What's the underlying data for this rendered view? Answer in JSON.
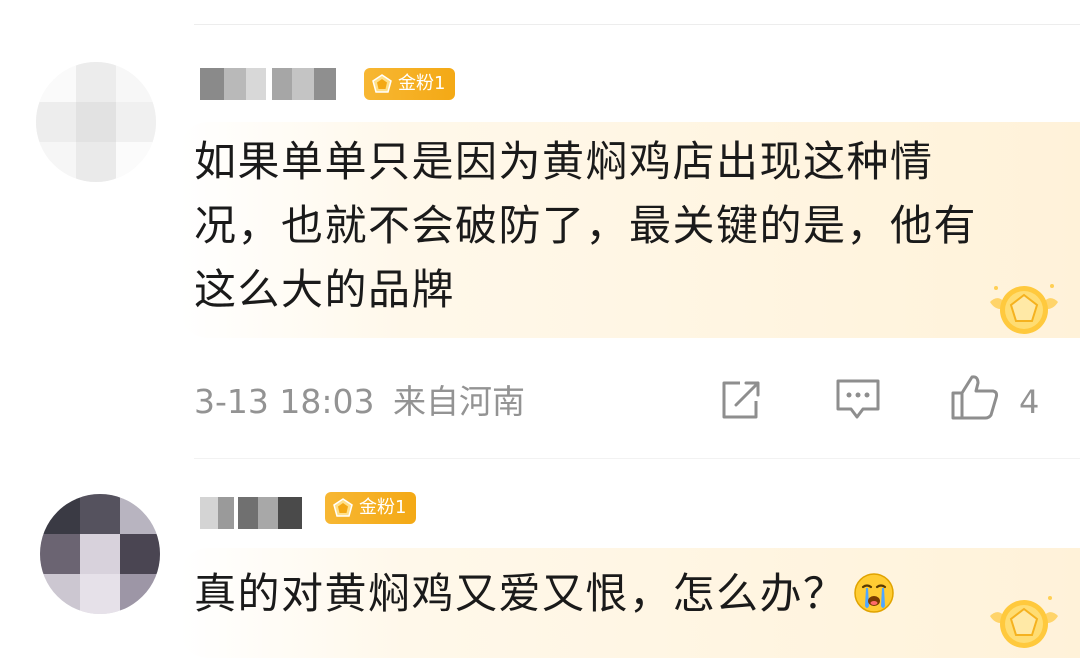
{
  "comments": [
    {
      "badge": "金粉1",
      "text": "如果单单只是因为黄焖鸡店出现这种情况，也就不会破防了，最关键的是，他有这么大的品牌",
      "timestamp": "3-13 18:03",
      "location": "来自河南",
      "likes": "4",
      "icons": {
        "share": "share-icon",
        "comment": "comment-icon",
        "like": "thumbs-up-icon",
        "medal": "gold-medal-icon"
      }
    },
    {
      "badge": "金粉1",
      "text": "真的对黄焖鸡又爱又恨，怎么办？",
      "emoji": "crying-face-emoji",
      "icons": {
        "medal": "gold-medal-icon"
      }
    }
  ],
  "colors": {
    "badge": "#f4a915",
    "meta": "#939393",
    "text": "#1a1a1a",
    "bubble": "#fff2d9"
  }
}
